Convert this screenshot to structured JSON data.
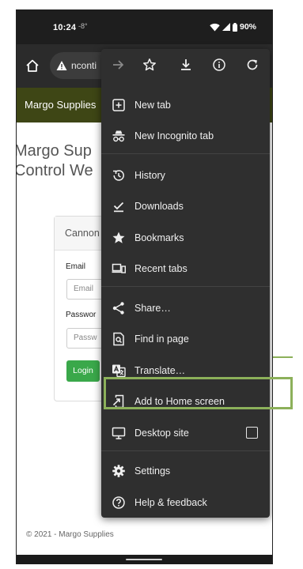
{
  "status_bar": {
    "time": "10:24",
    "temp": "-8°",
    "battery": "90%"
  },
  "url_bar": {
    "url_text": "nconti"
  },
  "site": {
    "nav_brand": "Margo Supplies",
    "page_title_line1": "Margo Sup",
    "page_title_line2": "Control We",
    "card_header": "Cannon",
    "email_label": "Email",
    "email_placeholder": "Email",
    "password_label": "Passwor",
    "password_placeholder": "Passw",
    "login_button": "Login",
    "footer": "© 2021 - Margo Supplies"
  },
  "menu": {
    "items": [
      {
        "label": "New tab",
        "icon": "new-tab-icon"
      },
      {
        "label": "New Incognito tab",
        "icon": "incognito-icon"
      },
      {
        "label": "History",
        "icon": "history-icon"
      },
      {
        "label": "Downloads",
        "icon": "downloads-icon"
      },
      {
        "label": "Bookmarks",
        "icon": "bookmarks-icon"
      },
      {
        "label": "Recent tabs",
        "icon": "recent-tabs-icon"
      },
      {
        "label": "Share…",
        "icon": "share-icon"
      },
      {
        "label": "Find in page",
        "icon": "find-in-page-icon"
      },
      {
        "label": "Translate…",
        "icon": "translate-icon"
      },
      {
        "label": "Add to Home screen",
        "icon": "add-to-home-icon"
      },
      {
        "label": "Desktop site",
        "icon": "desktop-icon"
      },
      {
        "label": "Settings",
        "icon": "settings-icon"
      },
      {
        "label": "Help & feedback",
        "icon": "help-icon"
      }
    ]
  },
  "colors": {
    "site_nav_bg": "#3e4615",
    "login_button": "#3aa84a",
    "menu_bg": "#2f2f2f",
    "highlight": "#8cb05a"
  }
}
